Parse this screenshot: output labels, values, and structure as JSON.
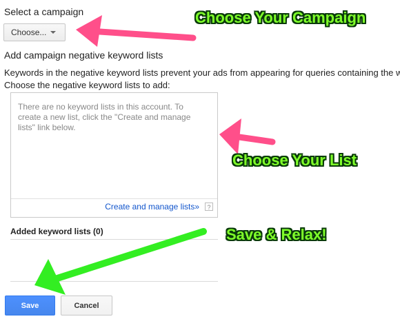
{
  "campaign": {
    "title": "Select a campaign",
    "dropdown_label": "Choose..."
  },
  "negative_lists": {
    "heading": "Add campaign negative keyword lists",
    "description": "Keywords in the negative keyword lists prevent your ads from appearing for queries containing the w",
    "choose_prompt": "Choose the negative keyword lists to add:",
    "empty_message": "There are no keyword lists in this account. To create a new list, click the \"Create and manage lists\" link below.",
    "manage_link": "Create and manage lists»",
    "help": "?"
  },
  "added": {
    "title": "Added keyword lists (0)"
  },
  "actions": {
    "save": "Save",
    "cancel": "Cancel"
  },
  "annotations": {
    "campaign": "Choose Your Campaign",
    "list": "Choose Your List",
    "save": "Save & Relax!"
  },
  "colors": {
    "pink_arrow": "#ff4f8a",
    "green_arrow": "#33ee22",
    "annotation_text": "#7fff2a",
    "link": "#1155cc",
    "primary_button": "#4d90fe"
  }
}
